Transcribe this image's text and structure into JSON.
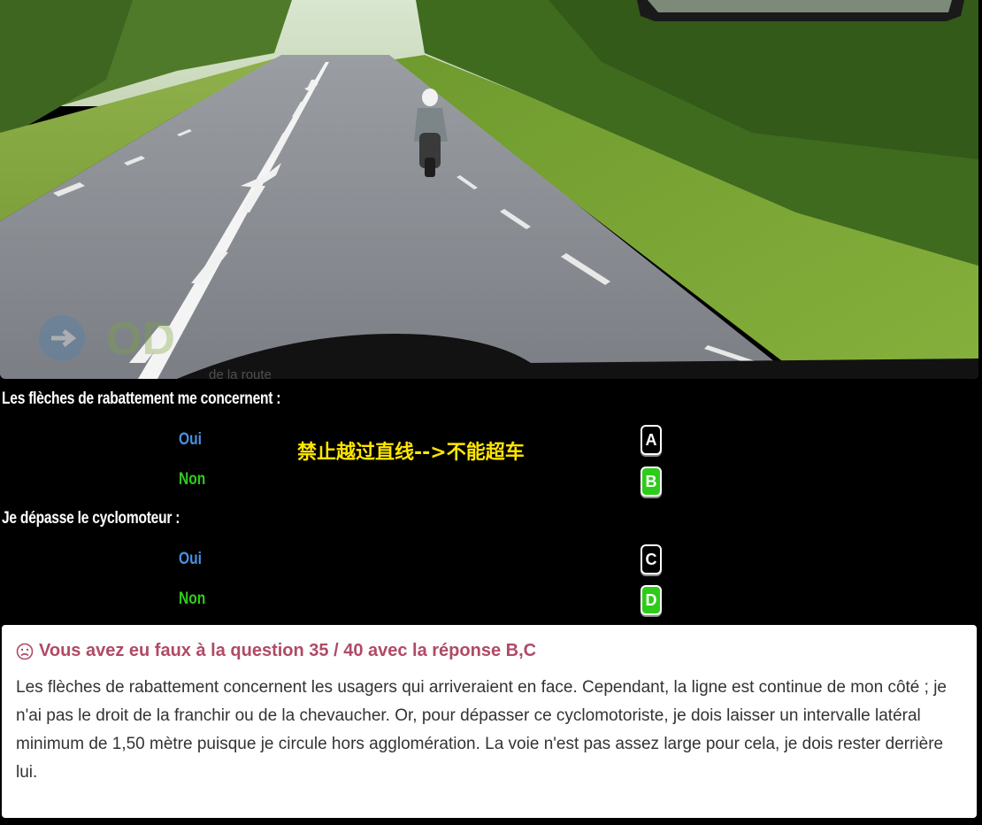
{
  "photo": {
    "watermark_text": "de la route"
  },
  "questions": [
    {
      "text": "Les flèches de rabattement me concernent :",
      "answers": [
        {
          "label": "Oui",
          "key": "A",
          "selected": false
        },
        {
          "label": "Non",
          "key": "B",
          "selected": true
        }
      ]
    },
    {
      "text": "Je dépasse le cyclomoteur :",
      "answers": [
        {
          "label": "Oui",
          "key": "C",
          "selected": false
        },
        {
          "label": "Non",
          "key": "D",
          "selected": true
        }
      ]
    }
  ],
  "annotation": "禁止越过直线-->不能超车",
  "result": {
    "title": "Vous avez eu faux à la question 35 / 40 avec la réponse B,C",
    "explanation": "Les flèches de rabattement concernent les usagers qui arriveraient en face. Cependant, la ligne est continue de mon côté ; je n'ai pas le droit de la franchir ou de la chevaucher. Or, pour dépasser ce cyclomotoriste, je dois laisser un intervalle latéral minimum de 1,50 mètre puisque je circule hors agglomération. La voie n'est pas assez large pour cela, je dois rester derrière lui."
  },
  "colors": {
    "oui": "#4a90e2",
    "non": "#2ecc1a",
    "selected_key": "#2ecc1a",
    "annotation": "#ffe600",
    "result_title": "#b04a66"
  }
}
